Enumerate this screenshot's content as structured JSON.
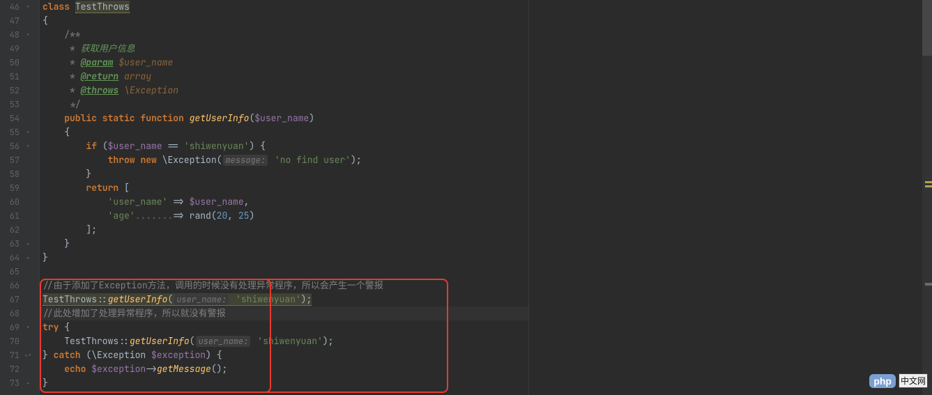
{
  "gutter": {
    "startLine": 46,
    "lines": [
      {
        "n": 46,
        "fold": "open-down"
      },
      {
        "n": 47,
        "fold": ""
      },
      {
        "n": 48,
        "fold": "open-down"
      },
      {
        "n": 49,
        "fold": ""
      },
      {
        "n": 50,
        "fold": ""
      },
      {
        "n": 51,
        "fold": ""
      },
      {
        "n": 52,
        "fold": ""
      },
      {
        "n": 53,
        "fold": ""
      },
      {
        "n": 54,
        "fold": ""
      },
      {
        "n": 55,
        "fold": "open-down"
      },
      {
        "n": 56,
        "fold": "open-down"
      },
      {
        "n": 57,
        "fold": ""
      },
      {
        "n": 58,
        "fold": ""
      },
      {
        "n": 59,
        "fold": ""
      },
      {
        "n": 60,
        "fold": ""
      },
      {
        "n": 61,
        "fold": ""
      },
      {
        "n": 62,
        "fold": ""
      },
      {
        "n": 63,
        "fold": "close"
      },
      {
        "n": 64,
        "fold": "close"
      },
      {
        "n": 65,
        "fold": ""
      },
      {
        "n": 66,
        "fold": ""
      },
      {
        "n": 67,
        "fold": ""
      },
      {
        "n": 68,
        "fold": ""
      },
      {
        "n": 69,
        "fold": "open-down"
      },
      {
        "n": 70,
        "fold": ""
      },
      {
        "n": 71,
        "fold": "close-open"
      },
      {
        "n": 72,
        "fold": ""
      },
      {
        "n": 73,
        "fold": "close"
      }
    ]
  },
  "code": {
    "l46": {
      "indent": "",
      "kw": "class",
      "cls": "TestThrows"
    },
    "l47": {
      "indent": "",
      "brace": "{"
    },
    "l48": {
      "indent": "    ",
      "doc": "/**"
    },
    "l49": {
      "indent": "     ",
      "star": "* ",
      "text": "获取用户信息"
    },
    "l50": {
      "indent": "     ",
      "star": "* ",
      "tag": "@param",
      "rest": " $user_name"
    },
    "l51": {
      "indent": "     ",
      "star": "* ",
      "tag": "@return",
      "rest": " array"
    },
    "l52": {
      "indent": "     ",
      "star": "* ",
      "tag": "@throws",
      "rest": " \\Exception"
    },
    "l53": {
      "indent": "     ",
      "star": "*/"
    },
    "l54": {
      "indent": "    ",
      "mods": "public static function",
      "fn": "getUserInfo",
      "open": "(",
      "var": "$user_name",
      "close": ")"
    },
    "l55": {
      "indent": "    ",
      "brace": "{"
    },
    "l56": {
      "indent": "        ",
      "kw": "if",
      "open": " (",
      "var": "$user_name",
      "eq": " == ",
      "str": "'shiwenyuan'",
      "close": ") {"
    },
    "l57": {
      "indent": "            ",
      "kw1": "throw",
      "kw2": "new",
      "cls": "\\Exception",
      "open": "(",
      "hint": "message:",
      "str": "'no find user'",
      "close": ");"
    },
    "l58": {
      "indent": "        ",
      "brace": "}"
    },
    "l59": {
      "indent": "        ",
      "kw": "return",
      "open": " ["
    },
    "l60": {
      "indent": "            ",
      "key": "'user_name'",
      "arrow": " => ",
      "var": "$user_name",
      "comma": ","
    },
    "l61": {
      "indent": "            ",
      "key": "'age'",
      "dots": ".......",
      "arrow": "=> ",
      "fn": "rand",
      "open": "(",
      "n1": "20",
      "c": ", ",
      "n2": "25",
      "close": ")"
    },
    "l62": {
      "indent": "        ",
      "close": "];"
    },
    "l63": {
      "indent": "    ",
      "brace": "}"
    },
    "l64": {
      "indent": "",
      "brace": "}"
    },
    "l65": {
      "indent": ""
    },
    "l66": {
      "indent": "",
      "cmt": "//由于添加了Exception方法，调用的时候没有处理异常程序，所以会产生一个警报"
    },
    "l67": {
      "indent": "",
      "clsCall": "TestThrows::",
      "fn": "getUserInfo",
      "open": "(",
      "hint": "user_name:",
      "str": "'shiwenyuan'",
      "close": ");"
    },
    "l68": {
      "indent": "",
      "cmt": "//此处增加了处理异常程序，所以就没有警报"
    },
    "l69": {
      "indent": "",
      "kw": "try",
      "brace": " {"
    },
    "l70": {
      "indent": "    ",
      "clsCall": "TestThrows::",
      "fn": "getUserInfo",
      "open": "(",
      "hint": "user_name:",
      "str": "'shiwenyuan'",
      "close": ");"
    },
    "l71": {
      "indent": "",
      "brace1": "} ",
      "kw": "catch",
      "open": " (",
      "cls": "\\Exception ",
      "var": "$exception",
      "close": ") {"
    },
    "l72": {
      "indent": "    ",
      "kw": "echo",
      "sp": " ",
      "var": "$exception",
      "arrow": "->",
      "fn": "getMessage",
      "tail": "();"
    },
    "l73": {
      "indent": "",
      "brace": "}"
    }
  },
  "highlightRow": 68,
  "logo": {
    "php": "php",
    "cn": "中文网"
  }
}
